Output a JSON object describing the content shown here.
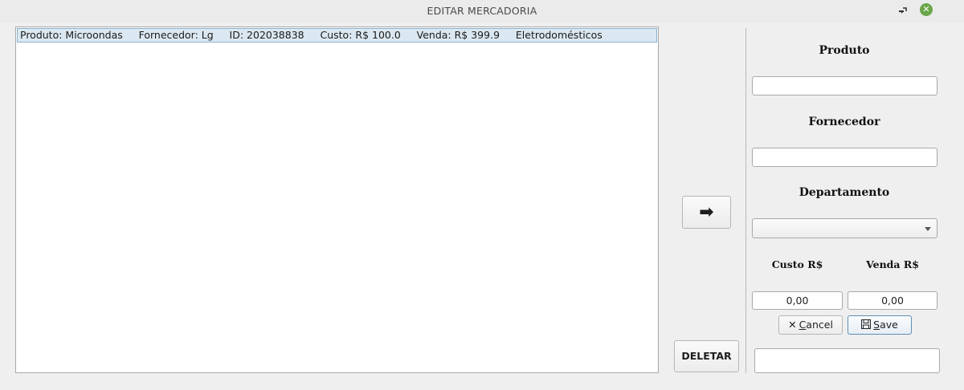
{
  "window": {
    "title": "EDITAR MERCADORIA",
    "minimize_icon": "minimize-icon",
    "restore_icon": "restore-icon",
    "close_icon": "close-icon",
    "close_color": "#6aa64a"
  },
  "list": {
    "items": [
      {
        "text": "Produto: Microondas     Fornecedor: Lg     ID: 202038838     Custo: R$ 100.0     Venda: R$ 399.9     Eletrodomésticos"
      }
    ],
    "selected_color": "#dbe8f1"
  },
  "actions": {
    "transfer_icon": "arrow-right-icon",
    "transfer_glyph": "➡",
    "delete_label": "DELETAR"
  },
  "form": {
    "produto_label": "Produto",
    "produto_value": "",
    "fornecedor_label": "Fornecedor",
    "fornecedor_value": "",
    "departamento_label": "Departamento",
    "departamento_value": "",
    "custo_label": "Custo R$",
    "custo_value": "0,00",
    "venda_label": "Venda R$",
    "venda_value": "0,00",
    "cancel_glyph": "✕",
    "cancel_rest": "ancel",
    "cancel_mnemonic": "C",
    "save_mnemonic": "S",
    "save_rest": "ave",
    "bottom_value": ""
  }
}
